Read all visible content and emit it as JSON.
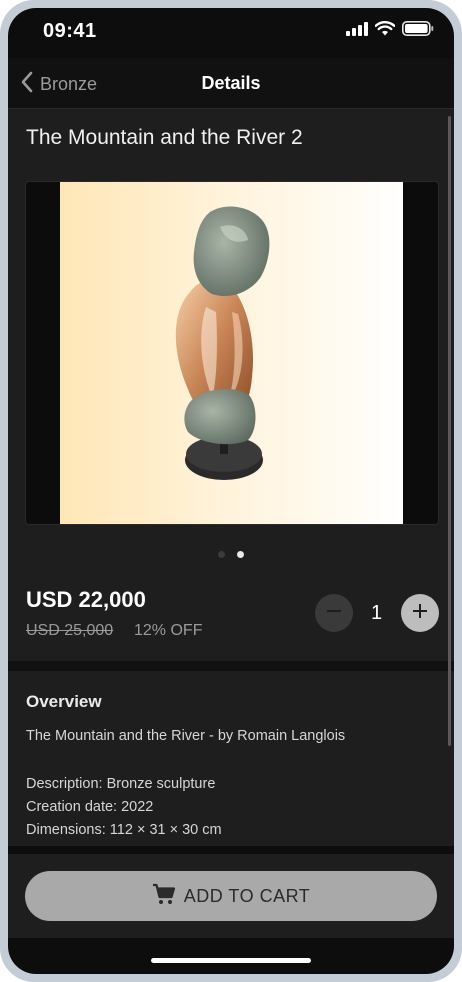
{
  "status_bar": {
    "time": "09:41"
  },
  "nav": {
    "back_label": "Bronze",
    "title": "Details"
  },
  "product": {
    "title": "The Mountain and the River 2",
    "gallery": {
      "page_count": 2,
      "current_page": 2
    },
    "price": "USD 22,000",
    "old_price": "USD 25,000",
    "discount": "12% OFF",
    "quantity": "1"
  },
  "overview": {
    "title": "Overview",
    "subtitle": "The Mountain and the River - by Romain Langlois",
    "lines": [
      "Description: Bronze sculpture",
      "Creation date: 2022",
      "Dimensions: 112 × 31 × 30 cm"
    ]
  },
  "footer": {
    "cart_label": "ADD TO CART"
  },
  "icons": {
    "back": "chevron-left-icon",
    "signal": "cellular-signal-icon",
    "wifi": "wifi-icon",
    "battery": "battery-icon",
    "minus": "minus-icon",
    "plus": "plus-icon",
    "cart": "shopping-cart-icon"
  },
  "colors": {
    "background": "#1e1e1e",
    "cart_button": "#a9a9a9",
    "plus_button": "#bdbdbd",
    "minus_button": "#3a3a3a"
  }
}
